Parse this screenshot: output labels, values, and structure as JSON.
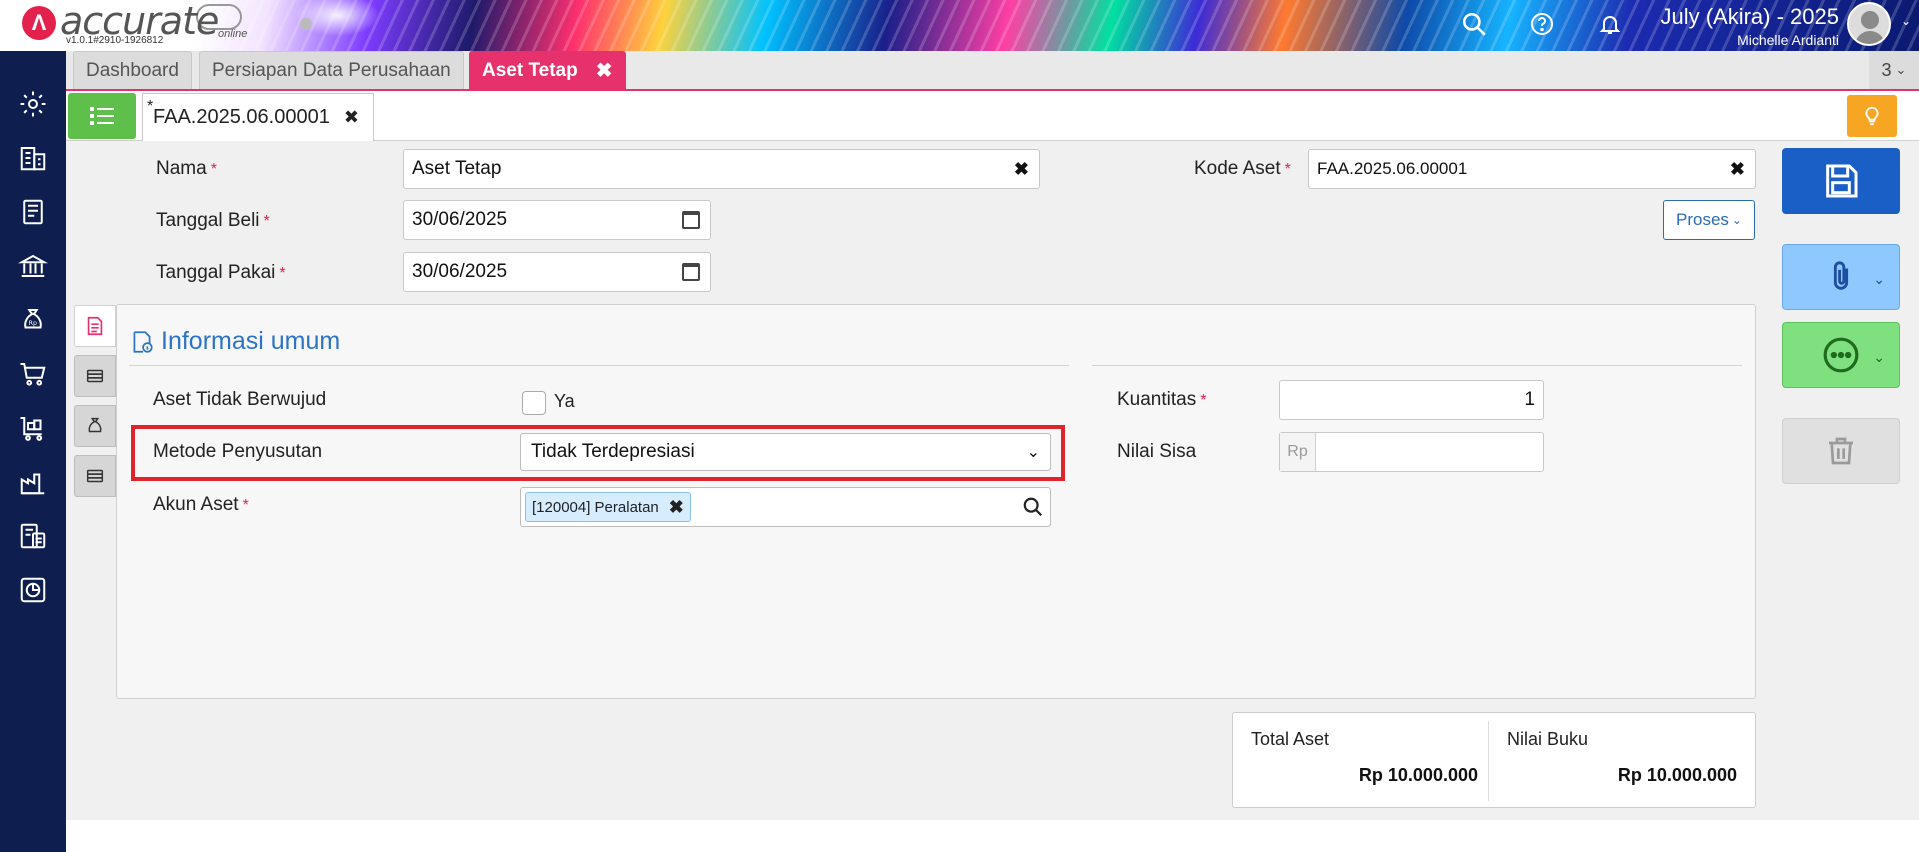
{
  "app": {
    "logo_text": "accurate",
    "logo_sub": "online",
    "version": "v1.0.1#2910-1926812",
    "period": "July (Akira) - 2025",
    "user": "Michelle Ardianti"
  },
  "header_icons": [
    "search-icon",
    "help-icon",
    "bell-icon"
  ],
  "tabs": [
    {
      "label": "Dashboard"
    },
    {
      "label": "Persiapan Data Perusahaan"
    },
    {
      "label": "Aset Tetap",
      "active": true
    }
  ],
  "tab_count": "3",
  "doc_tab": {
    "marker": "*",
    "label": "FAA.2025.06.00001"
  },
  "form": {
    "nama_label": "Nama",
    "nama_value": "Aset Tetap",
    "tgl_beli_label": "Tanggal Beli",
    "tgl_beli_value": "30/06/2025",
    "tgl_pakai_label": "Tanggal Pakai",
    "tgl_pakai_value": "30/06/2025",
    "kode_label": "Kode Aset",
    "kode_value": "FAA.2025.06.00001",
    "proses_label": "Proses"
  },
  "panel": {
    "title": "Informasi umum",
    "tidak_berwujud_label": "Aset Tidak Berwujud",
    "tidak_berwujud_option": "Ya",
    "tidak_berwujud_checked": false,
    "metode_label": "Metode Penyusutan",
    "metode_value": "Tidak Terdepresiasi",
    "akun_label": "Akun Aset",
    "akun_tag": "[120004] Peralatan",
    "kuantitas_label": "Kuantitas",
    "kuantitas_value": "1",
    "nilai_sisa_label": "Nilai Sisa",
    "nilai_sisa_prefix": "Rp",
    "nilai_sisa_value": ""
  },
  "totals": {
    "total_aset_label": "Total Aset",
    "total_aset_value": "Rp 10.000.000",
    "nilai_buku_label": "Nilai Buku",
    "nilai_buku_value": "Rp 10.000.000"
  },
  "colors": {
    "nav_bg": "#0d1e4f",
    "accent_pink": "#e6316c",
    "save_blue": "#1a5fc6",
    "highlight_red": "#e0242b",
    "title_blue": "#2b73c4"
  }
}
